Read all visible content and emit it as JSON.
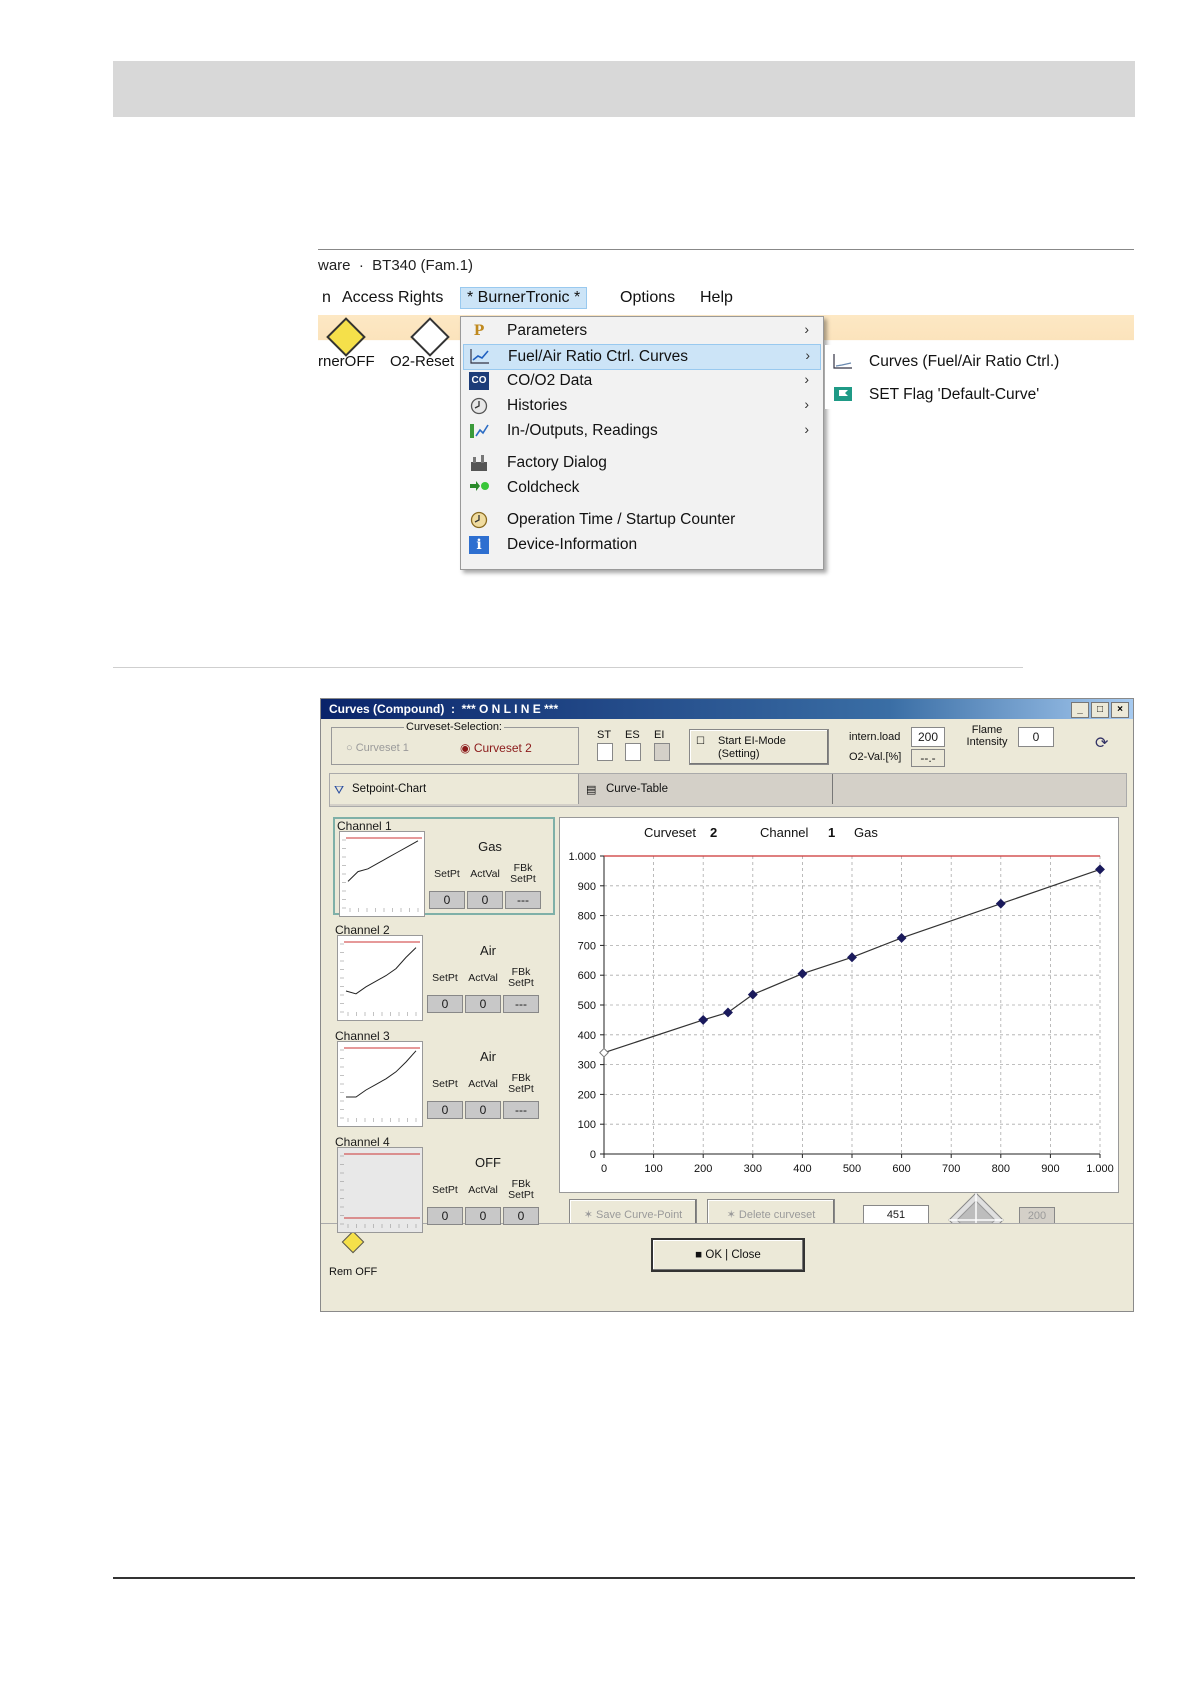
{
  "menu_window": {
    "title": "ware  ·  BT340 (Fam.1)",
    "menubar": [
      {
        "label": "Access Rights"
      },
      {
        "label": "* BurnerTronic *"
      },
      {
        "label": "Options"
      },
      {
        "label": "Help"
      }
    ],
    "menubar_left_fragment": "n",
    "toolbar": {
      "burner_off_label": "rnerOFF",
      "o2_reset_label": "O2-Reset"
    },
    "dropdown": [
      {
        "icon": "parameters-icon",
        "label": "Parameters",
        "submenu": true
      },
      {
        "icon": "curve-chart-icon",
        "label": "Fuel/Air Ratio Ctrl. Curves",
        "submenu": true,
        "highlighted": true
      },
      {
        "icon": "co-o2-icon",
        "label": "CO/O2 Data",
        "submenu": true
      },
      {
        "icon": "histories-clock-icon",
        "label": "Histories",
        "submenu": true
      },
      {
        "icon": "in-outputs-icon",
        "label": "In-/Outputs, Readings",
        "submenu": true
      },
      {
        "icon": "factory-icon",
        "label": "Factory Dialog",
        "submenu": false
      },
      {
        "icon": "coldcheck-icon",
        "label": "Coldcheck",
        "submenu": false
      },
      {
        "icon": "clock-icon",
        "label": "Operation Time / Startup Counter",
        "submenu": false
      },
      {
        "icon": "info-icon",
        "label": "Device-Information",
        "submenu": false
      }
    ],
    "submenu": [
      {
        "icon": "curve-chart-icon",
        "label": "Curves (Fuel/Air Ratio Ctrl.)"
      },
      {
        "icon": "flag-icon",
        "label": "SET Flag 'Default-Curve'"
      }
    ]
  },
  "curves_dialog": {
    "title": "Curves (Compound)  :  *** O N L I N E ***",
    "curveset_selection": {
      "legend": "Curveset-Selection:",
      "option1": "Curveset 1",
      "option2": "Curveset 2",
      "selected": "Curveset 2"
    },
    "flags": [
      "ST",
      "ES",
      "EI"
    ],
    "ei_mode_button": {
      "line1": "Start EI-Mode",
      "line2": "(Setting)"
    },
    "intern_load": {
      "label": "intern.load",
      "value": "200"
    },
    "o2_val": {
      "label": "O2-Val.[%]",
      "value": "--.-"
    },
    "flame_intensity": {
      "label": "Flame Intensity",
      "value": "0"
    },
    "tabs": [
      {
        "label": "Setpoint-Chart",
        "icon": "chart-icon"
      },
      {
        "label": "Curve-Table",
        "icon": "table-icon"
      }
    ],
    "col_headers": {
      "setpt": "SetPt",
      "actval": "ActVal",
      "fbk_setpt": "FBk SetPt"
    },
    "channels": [
      {
        "name": "Channel 1",
        "medium": "Gas",
        "setpt": "0",
        "actval": "0",
        "fbk": "---",
        "mini": [
          0.38,
          0.52,
          0.56,
          0.64,
          0.72,
          0.8,
          0.88,
          0.96
        ]
      },
      {
        "name": "Channel 2",
        "medium": "Air",
        "setpt": "0",
        "actval": "0",
        "fbk": "---",
        "mini": [
          0.3,
          0.26,
          0.36,
          0.44,
          0.52,
          0.62,
          0.78,
          0.92
        ]
      },
      {
        "name": "Channel 3",
        "medium": "Air",
        "setpt": "0",
        "actval": "0",
        "fbk": "---",
        "mini": [
          0.3,
          0.3,
          0.4,
          0.48,
          0.56,
          0.66,
          0.8,
          0.96
        ]
      },
      {
        "name": "Channel 4",
        "medium": "OFF",
        "setpt": "0",
        "actval": "0",
        "fbk": "0",
        "mini": []
      }
    ],
    "plot_header": {
      "curveset_label": "Curveset",
      "curveset_value": "2",
      "channel_label": "Channel",
      "channel_value": "1",
      "medium": "Gas"
    },
    "save_button": "Save Curve-Point",
    "delete_button": "Delete curveset",
    "point_value": "451",
    "load_value": "200",
    "ok_button": "OK | Close",
    "rem_off_label": "Rem OFF"
  },
  "chart_data": {
    "type": "line",
    "title": "",
    "xlabel": "",
    "ylabel": "",
    "xlim": [
      0,
      1000
    ],
    "ylim": [
      0,
      1000
    ],
    "x_ticks": [
      "0",
      "100",
      "200",
      "300",
      "400",
      "500",
      "600",
      "700",
      "800",
      "900",
      "1.000"
    ],
    "y_ticks": [
      "0",
      "100",
      "200",
      "300",
      "400",
      "500",
      "600",
      "700",
      "800",
      "900",
      "1.000"
    ],
    "grid": true,
    "series": [
      {
        "x": [
          0,
          200,
          250,
          300,
          400,
          500,
          600,
          800,
          1000
        ],
        "y": [
          340,
          450,
          475,
          535,
          605,
          660,
          725,
          840,
          955
        ],
        "color": "#1a1a5c"
      }
    ],
    "upper_limit": {
      "y": 1000,
      "color": "#cc3333"
    }
  }
}
